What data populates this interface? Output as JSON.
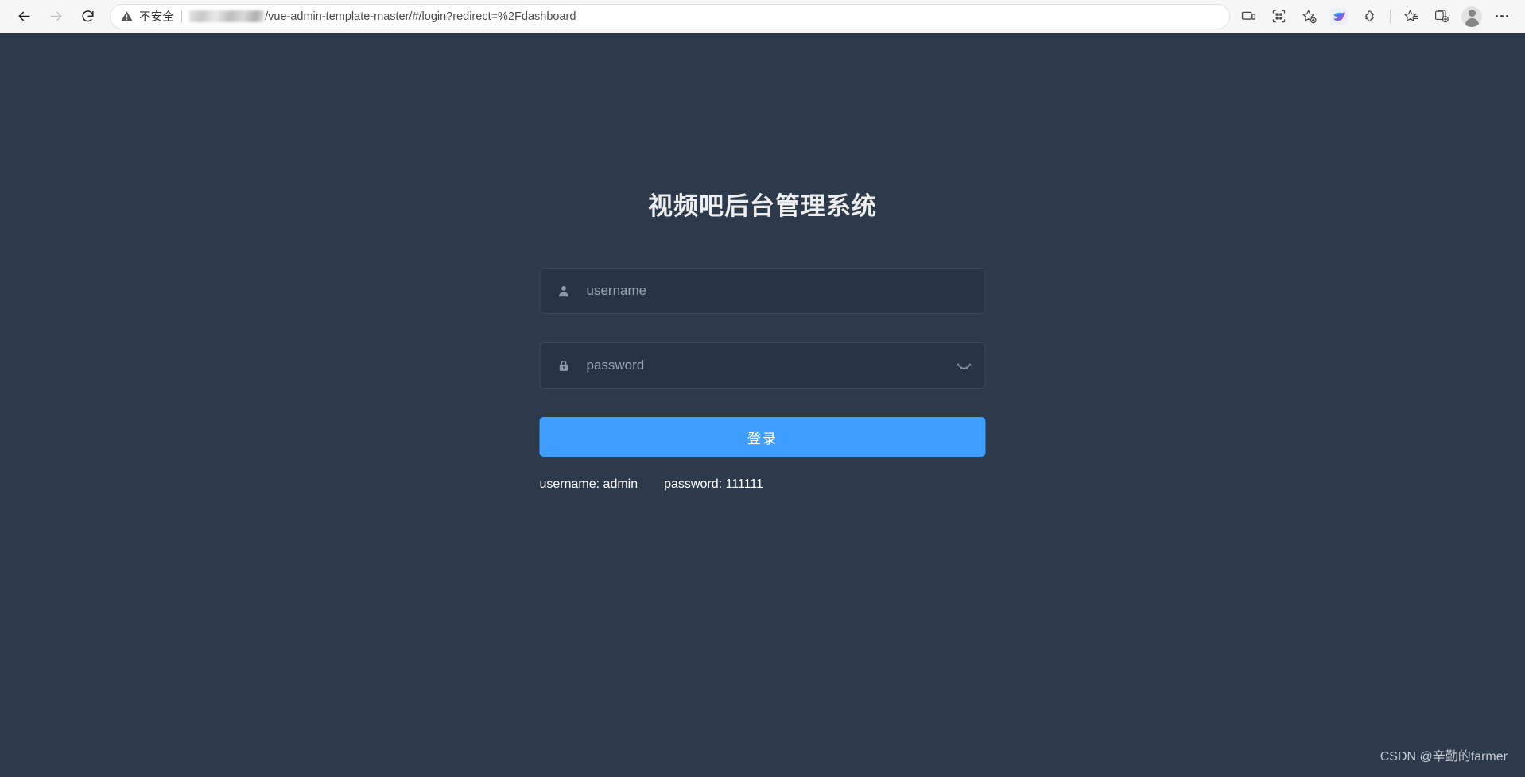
{
  "browser": {
    "back_tooltip": "返回",
    "forward_tooltip": "前进",
    "reload_tooltip": "刷新",
    "security_label": "不安全",
    "url_text": "/vue-admin-template-master/#/login?redirect=%2Fdashboard",
    "url_redacted": "",
    "icons": {
      "warning": "warning-triangle-icon",
      "cast": "cast-device-icon",
      "collections_grid": "app-grid-icon",
      "add_favorite": "add-favorite-star-icon",
      "extension_bird": "bird-extension-icon",
      "extensions_puzzle": "extensions-puzzle-icon",
      "favorites": "favorites-list-icon",
      "collections": "collections-icon",
      "profile": "profile-avatar-icon",
      "settings_more": "more-settings-icon"
    }
  },
  "page": {
    "title": "视频吧后台管理系统",
    "background_color": "#2d3a4b",
    "accent_color": "#409eff",
    "field_background": "#283443"
  },
  "form": {
    "username": {
      "value": "",
      "placeholder": "username",
      "icon": "user-icon"
    },
    "password": {
      "value": "",
      "placeholder": "password",
      "icon": "lock-icon",
      "toggle_icon": "eye-off-icon",
      "visible": false
    },
    "submit_label": "登录"
  },
  "tips": {
    "username_hint": "username: admin",
    "password_hint": "password: 111111"
  },
  "watermark": {
    "text": "CSDN @辛勤的farmer"
  }
}
